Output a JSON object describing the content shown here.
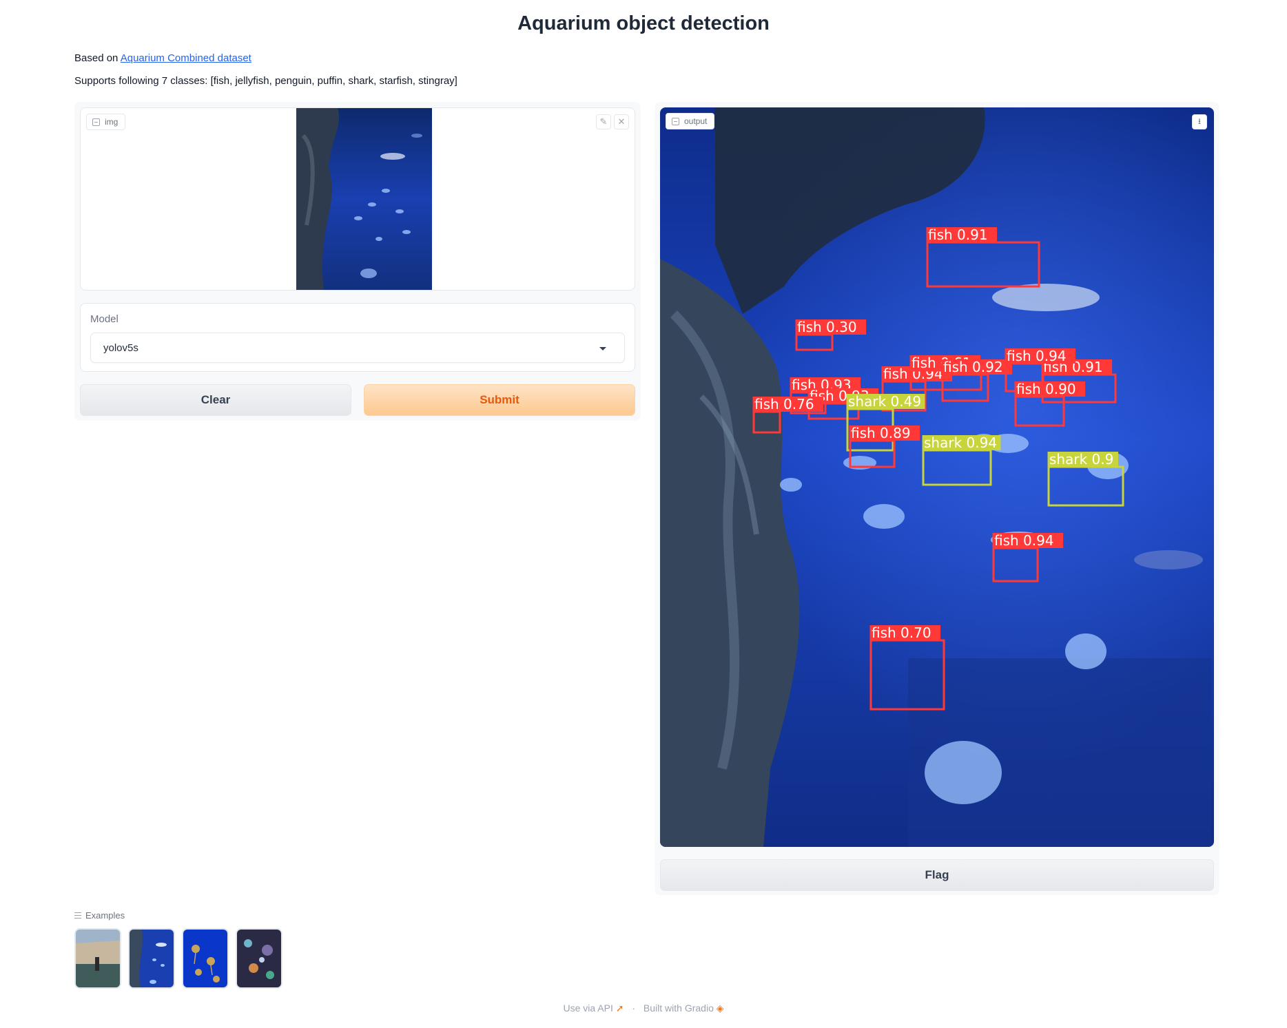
{
  "title": "Aquarium object detection",
  "description": {
    "based_on_prefix": "Based on ",
    "dataset_link_text": "Aquarium Combined dataset",
    "classes_text": "Supports following 7 classes: [fish, jellyfish, penguin, puffin, shark, starfish, stingray]"
  },
  "input_image": {
    "label": "img",
    "edit_icon": "pencil-icon",
    "close_icon": "close-icon"
  },
  "model": {
    "label": "Model",
    "selected": "yolov5s"
  },
  "buttons": {
    "clear": "Clear",
    "submit": "Submit",
    "flag": "Flag"
  },
  "output": {
    "label": "output",
    "download_icon": "download-icon",
    "detections": [
      {
        "class": "fish",
        "score": "0.91",
        "text": "fish 0.91"
      },
      {
        "class": "fish",
        "score": "0.30",
        "text": "fish 0.30"
      },
      {
        "class": "fish",
        "score": "0.94",
        "text": "fish 0.94"
      },
      {
        "class": "fish",
        "score": "0.91",
        "text": "fish 0.91"
      },
      {
        "class": "fish",
        "score": "0.61",
        "text": "fish 0.61"
      },
      {
        "class": "fish",
        "score": "0.92",
        "text": "fish 0.92"
      },
      {
        "class": "fish",
        "score": "0.94",
        "text": "fish 0.94"
      },
      {
        "class": "fish",
        "score": "0.93",
        "text": "fish 0.93"
      },
      {
        "class": "fish",
        "score": "0.93",
        "text": "fish 0.93"
      },
      {
        "class": "fish",
        "score": "0.90",
        "text": "fish 0.90"
      },
      {
        "class": "shark",
        "score": "0.49",
        "text": "shark 0.49"
      },
      {
        "class": "fish",
        "score": "0.76",
        "text": "fish 0.76"
      },
      {
        "class": "fish",
        "score": "0.89",
        "text": "fish 0.89"
      },
      {
        "class": "shark",
        "score": "0.94",
        "text": "shark 0.94"
      },
      {
        "class": "shark",
        "score": "0.9",
        "text": "shark 0.9"
      },
      {
        "class": "fish",
        "score": "0.94",
        "text": "fish 0.94"
      },
      {
        "class": "fish",
        "score": "0.70",
        "text": "fish 0.70"
      }
    ]
  },
  "examples": {
    "label": "Examples",
    "items": [
      "example-1",
      "example-2",
      "example-3",
      "example-4"
    ]
  },
  "footer": {
    "api": "Use via API",
    "separator": "·",
    "built": "Built with Gradio"
  },
  "colors": {
    "fish_box": "#ff3838",
    "shark_box": "#c8d43b",
    "accent_orange": "#ea580c",
    "link_blue": "#2563eb"
  }
}
